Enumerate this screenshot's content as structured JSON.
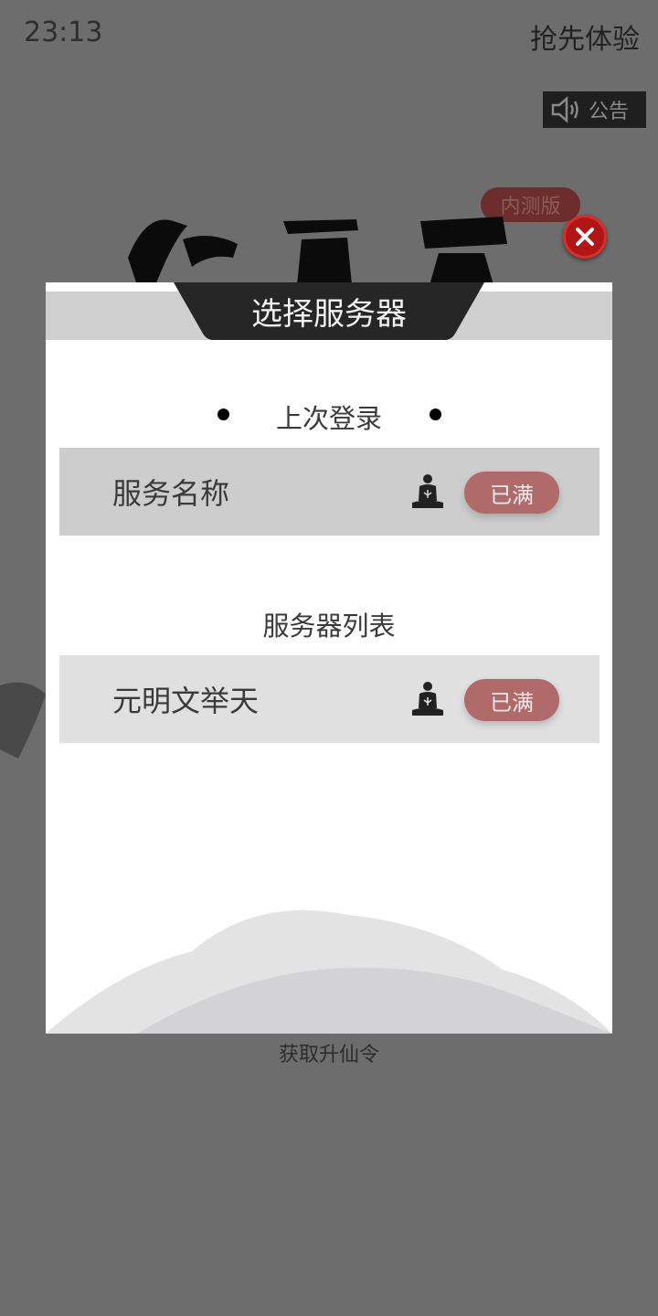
{
  "status_bar": {
    "time": "23:13"
  },
  "header": {
    "early_access": "抢先体验",
    "notice_label": "公告",
    "beta_badge": "内测版"
  },
  "modal": {
    "title": "选择服务器",
    "last_login": {
      "label": "上次登录",
      "server": {
        "name": "服务名称",
        "status": "已满"
      }
    },
    "server_list": {
      "label": "服务器列表",
      "servers": [
        {
          "name": "元明文举天",
          "status": "已满"
        }
      ]
    }
  },
  "footer": {
    "link": "获取升仙令"
  },
  "colors": {
    "overlay": "#6b6b6b",
    "status_full": "#b06a6a",
    "close_red": "#b21515",
    "title_tab": "#262626"
  },
  "icons": {
    "notice": "speaker-icon",
    "close": "close-icon",
    "player": "meditating-figure-icon"
  }
}
